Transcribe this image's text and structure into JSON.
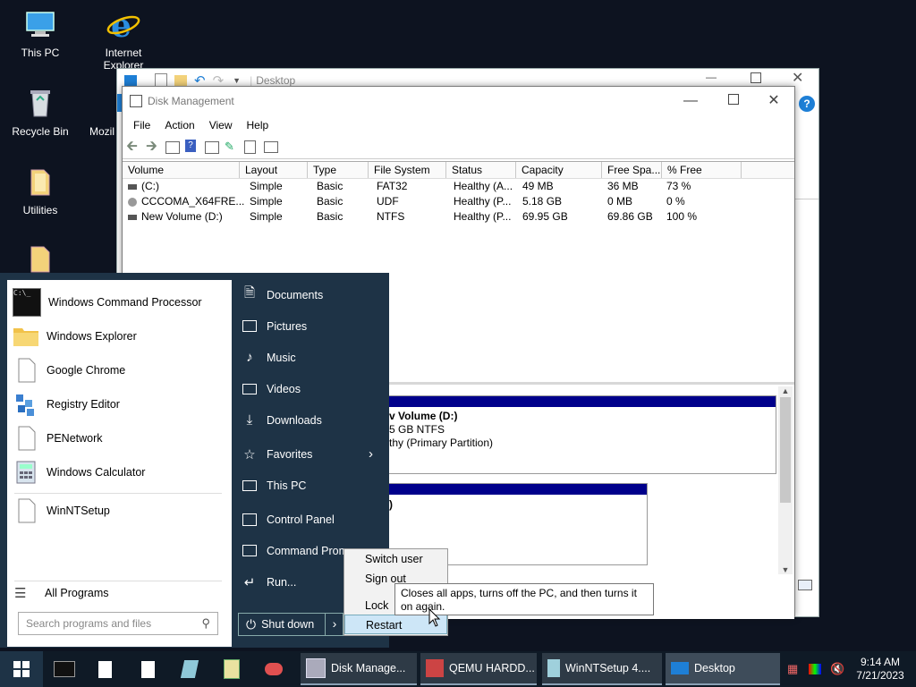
{
  "desktop_icons": [
    {
      "label": "This PC"
    },
    {
      "label": "Internet Explorer"
    },
    {
      "label": "Recycle Bin"
    },
    {
      "label": "Mozil"
    },
    {
      "label": "Utilities"
    }
  ],
  "back_window": {
    "title": "Desktop"
  },
  "disk_management": {
    "title": "Disk Management",
    "menu": [
      "File",
      "Action",
      "View",
      "Help"
    ],
    "columns": [
      "Volume",
      "Layout",
      "Type",
      "File System",
      "Status",
      "Capacity",
      "Free Spa...",
      "% Free"
    ],
    "rows": [
      [
        "(C:)",
        "Simple",
        "Basic",
        "FAT32",
        "Healthy (A...",
        "49 MB",
        "36 MB",
        "73 %"
      ],
      [
        "CCCOMA_X64FRE...",
        "Simple",
        "Basic",
        "UDF",
        "Healthy (P...",
        "5.18 GB",
        "0 MB",
        "0 %"
      ],
      [
        "New Volume (D:)",
        "Simple",
        "Basic",
        "NTFS",
        "Healthy (P...",
        "69.95 GB",
        "69.86 GB",
        "100 %"
      ]
    ],
    "partition": {
      "name": "v Volume  (D:)",
      "size": "5 GB NTFS",
      "status": "thy (Primary Partition)",
      "second": ")"
    }
  },
  "start_menu": {
    "programs": [
      {
        "label": "Windows Command Processor"
      },
      {
        "label": "Windows Explorer"
      },
      {
        "label": "Google Chrome"
      },
      {
        "label": "Registry Editor"
      },
      {
        "label": "PENetwork"
      },
      {
        "label": "Windows Calculator"
      },
      {
        "label": "WinNTSetup"
      }
    ],
    "all_programs": "All Programs",
    "search_placeholder": "Search programs and files",
    "right": [
      {
        "label": "Documents"
      },
      {
        "label": "Pictures"
      },
      {
        "label": "Music"
      },
      {
        "label": "Videos"
      },
      {
        "label": "Downloads"
      },
      {
        "label": "Favorites"
      },
      {
        "label": "This PC"
      },
      {
        "label": "Control Panel"
      },
      {
        "label": "Command Prom"
      },
      {
        "label": "Run..."
      }
    ],
    "shutdown_label": "Shut down",
    "context_menu": [
      "Switch user",
      "Sign out",
      "Lock",
      "Restart"
    ],
    "tooltip": "Closes all apps, turns off the PC, and then turns it on again."
  },
  "taskbar": {
    "apps": [
      {
        "label": "Disk Manage..."
      },
      {
        "label": "QEMU HARDD..."
      },
      {
        "label": "WinNTSetup 4...."
      },
      {
        "label": "Desktop"
      }
    ],
    "time": "9:14 AM",
    "date": "7/21/2023"
  },
  "colors": {
    "start_bg": "#1e3346",
    "taskbar_bg": "#0f1a26",
    "partition_bar": "#00008b",
    "accent": "#1e7fd6"
  }
}
